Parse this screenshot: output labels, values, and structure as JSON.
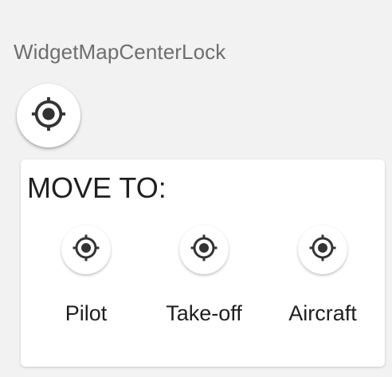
{
  "widget": {
    "title": "WidgetMapCenterLock",
    "lock_icon": "gps-crosshair-icon"
  },
  "move_to": {
    "title": "MOVE TO:",
    "targets": [
      {
        "label": "Pilot",
        "icon": "gps-crosshair-icon"
      },
      {
        "label": "Take-off",
        "icon": "gps-crosshair-icon"
      },
      {
        "label": "Aircraft",
        "icon": "gps-crosshair-icon"
      }
    ]
  },
  "colors": {
    "background": "#f2f2f2",
    "panel": "#ffffff",
    "icon": "#333333",
    "title_text": "#6e6e6e",
    "text": "#1f1f1f"
  }
}
